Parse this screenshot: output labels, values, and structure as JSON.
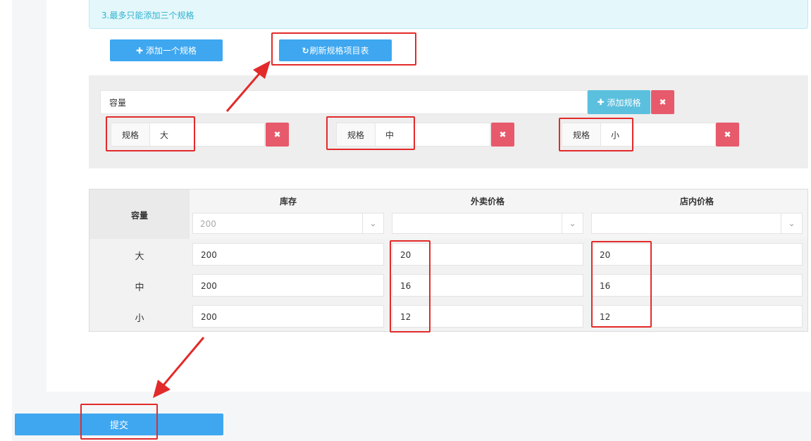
{
  "notice": "3.最多只能添加三个规格",
  "toolbar": {
    "add_spec_label": "添加一个规格",
    "refresh_label": "刷新规格项目表"
  },
  "spec_group": {
    "name_value": "容量",
    "add_item_label": "添加规格",
    "remove_group": "✖",
    "items": [
      {
        "addon": "规格",
        "value": "大",
        "remove": "✖"
      },
      {
        "addon": "规格",
        "value": "中",
        "remove": "✖"
      },
      {
        "addon": "规格",
        "value": "小",
        "remove": "✖"
      }
    ]
  },
  "table": {
    "corner_header": "容量",
    "columns": [
      "库存",
      "外卖价格",
      "店内价格"
    ],
    "batch_inputs": {
      "stock_placeholder": "200",
      "delivery_placeholder": "",
      "store_placeholder": ""
    },
    "rows": [
      {
        "label": "大",
        "stock": "200",
        "delivery": "20",
        "store": "20"
      },
      {
        "label": "中",
        "stock": "200",
        "delivery": "16",
        "store": "16"
      },
      {
        "label": "小",
        "stock": "200",
        "delivery": "12",
        "store": "12"
      }
    ]
  },
  "submit_label": "提交",
  "icons": {
    "plus": "plus-icon",
    "refresh": "refresh-icon",
    "remove": "close-icon",
    "dropdown": "double-chevron-down-icon"
  },
  "colors": {
    "primary": "#3ea7f0",
    "info": "#5bc0de",
    "danger": "#e75a6b",
    "annotation": "#e32a2a"
  }
}
